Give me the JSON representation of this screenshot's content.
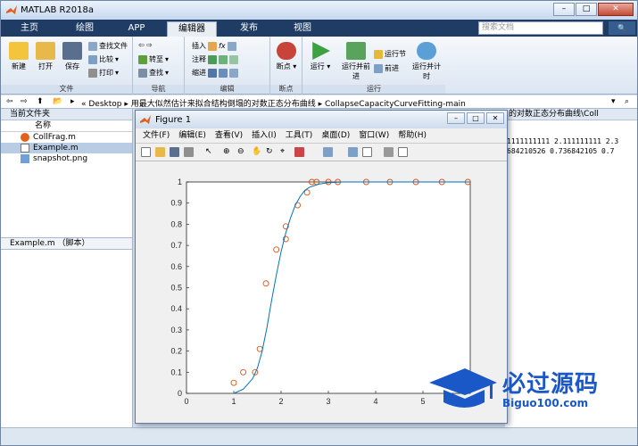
{
  "window": {
    "title": "MATLAB R2018a"
  },
  "tabs": [
    "主页",
    "绘图",
    "APP",
    "编辑器",
    "发布",
    "视图"
  ],
  "active_tab": "编辑器",
  "search": {
    "placeholder": "搜索文档"
  },
  "ribbon": {
    "file_group": {
      "label": "文件",
      "new": "新建",
      "open": "打开",
      "save": "保存",
      "find_files": "查找文件",
      "compare": "比较",
      "print": "打印"
    },
    "nav_group": {
      "label": "导航",
      "goto": "转至",
      "find": "查找"
    },
    "edit_group": {
      "label": "编辑",
      "insert": "插入",
      "comment": "注释",
      "indent": "缩进"
    },
    "breakpoint_group": {
      "label": "断点",
      "breakpoints": "断点"
    },
    "run_group": {
      "label": "运行",
      "run": "运行",
      "run_advance": "运行并前进",
      "run_section": "运行节",
      "advance": "前进",
      "run_time": "运行并计时"
    }
  },
  "address": {
    "path": "« Desktop  ▸  用最大似然估计来拟合结构倒塌的对数正态分布曲线  ▸  CollapseCapacityCurveFitting-main"
  },
  "current_folder": {
    "title": "当前文件夹",
    "column": "名称",
    "files": [
      {
        "name": "CollFrag.m",
        "icon": "matlab-icon"
      },
      {
        "name": "Example.m",
        "icon": "script-icon"
      },
      {
        "name": "snapshot.png",
        "icon": "image-icon"
      }
    ],
    "details": "Example.m （脚本）"
  },
  "command_window": {
    "header": "的对数正态分布曲线\\Coll",
    "lines": [
      "1111111111 2.111111111 2.3",
      "684210526 0.736842105 0.7"
    ]
  },
  "figure": {
    "title": "Figure 1",
    "menu": [
      "文件(F)",
      "编辑(E)",
      "查看(V)",
      "插入(I)",
      "工具(T)",
      "桌面(D)",
      "窗口(W)",
      "帮助(H)"
    ]
  },
  "chart_data": {
    "type": "scatter",
    "title": "",
    "xlabel": "",
    "ylabel": "",
    "xlim": [
      0,
      6
    ],
    "ylim": [
      0,
      1
    ],
    "xticks": [
      0,
      1,
      2,
      3,
      4,
      5,
      6
    ],
    "yticks": [
      0,
      0.1,
      0.2,
      0.3,
      0.4,
      0.5,
      0.6,
      0.7,
      0.8,
      0.9,
      1
    ],
    "series": [
      {
        "kind": "points",
        "color": "#d95319",
        "x": [
          1.0,
          1.2,
          1.45,
          1.55,
          1.68,
          1.9,
          2.1,
          2.1,
          2.35,
          2.55,
          2.65,
          2.75,
          3.0,
          3.2,
          3.8,
          4.3,
          4.85,
          5.4,
          5.95
        ],
        "y": [
          0.05,
          0.1,
          0.1,
          0.21,
          0.52,
          0.68,
          0.73,
          0.79,
          0.89,
          0.95,
          1.0,
          1.0,
          1.0,
          1.0,
          1.0,
          1.0,
          1.0,
          1.0,
          1.0
        ]
      },
      {
        "kind": "curve",
        "color": "#0072bd",
        "x": [
          1.0,
          1.2,
          1.4,
          1.5,
          1.6,
          1.7,
          1.8,
          1.9,
          2.0,
          2.1,
          2.2,
          2.3,
          2.4,
          2.5,
          2.6,
          2.8,
          3.0,
          3.3,
          3.6,
          4.0,
          5.0,
          6.0
        ],
        "y": [
          0.0,
          0.02,
          0.07,
          0.12,
          0.2,
          0.31,
          0.44,
          0.56,
          0.67,
          0.76,
          0.83,
          0.89,
          0.93,
          0.96,
          0.975,
          0.99,
          0.997,
          1.0,
          1.0,
          1.0,
          1.0,
          1.0
        ]
      }
    ]
  },
  "watermark": {
    "brand": "必过源码",
    "url": "Biguo100.com"
  }
}
